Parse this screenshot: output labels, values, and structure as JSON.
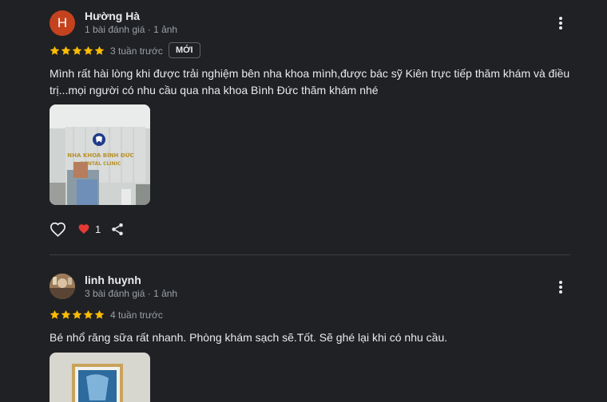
{
  "reviews": [
    {
      "avatar_letter": "H",
      "avatar_color": "#c5421f",
      "name": "Hường Hà",
      "meta": "1 bài đánh giá · 1 ảnh",
      "rating": 5,
      "time": "3 tuần trước",
      "badge": "MỚI",
      "text": "Mình rất hài lòng khi được trải nghiệm bên nha khoa mình,được bác sỹ Kiên trực tiếp thăm khám và điều trị...mọi người có nhu cầu qua nha khoa Bình Đức thăm khám nhé",
      "photo_sign_line1": "NHA KHOA BÌNH ĐỨC",
      "photo_sign_line2": "DENTAL CLINIC",
      "like_count": "1"
    },
    {
      "name": "linh huynh",
      "meta": "3 bài đánh giá · 1 ảnh",
      "rating": 5,
      "time": "4 tuần trước",
      "text": "Bé nhổ răng sữa rất nhanh. Phòng khám sạch sẽ.Tốt. Sẽ ghé lại khi có nhu cầu."
    }
  ],
  "colors": {
    "background": "#202124",
    "star": "#fbbc04",
    "heart": "#e53935",
    "secondary_text": "#9aa0a6"
  }
}
